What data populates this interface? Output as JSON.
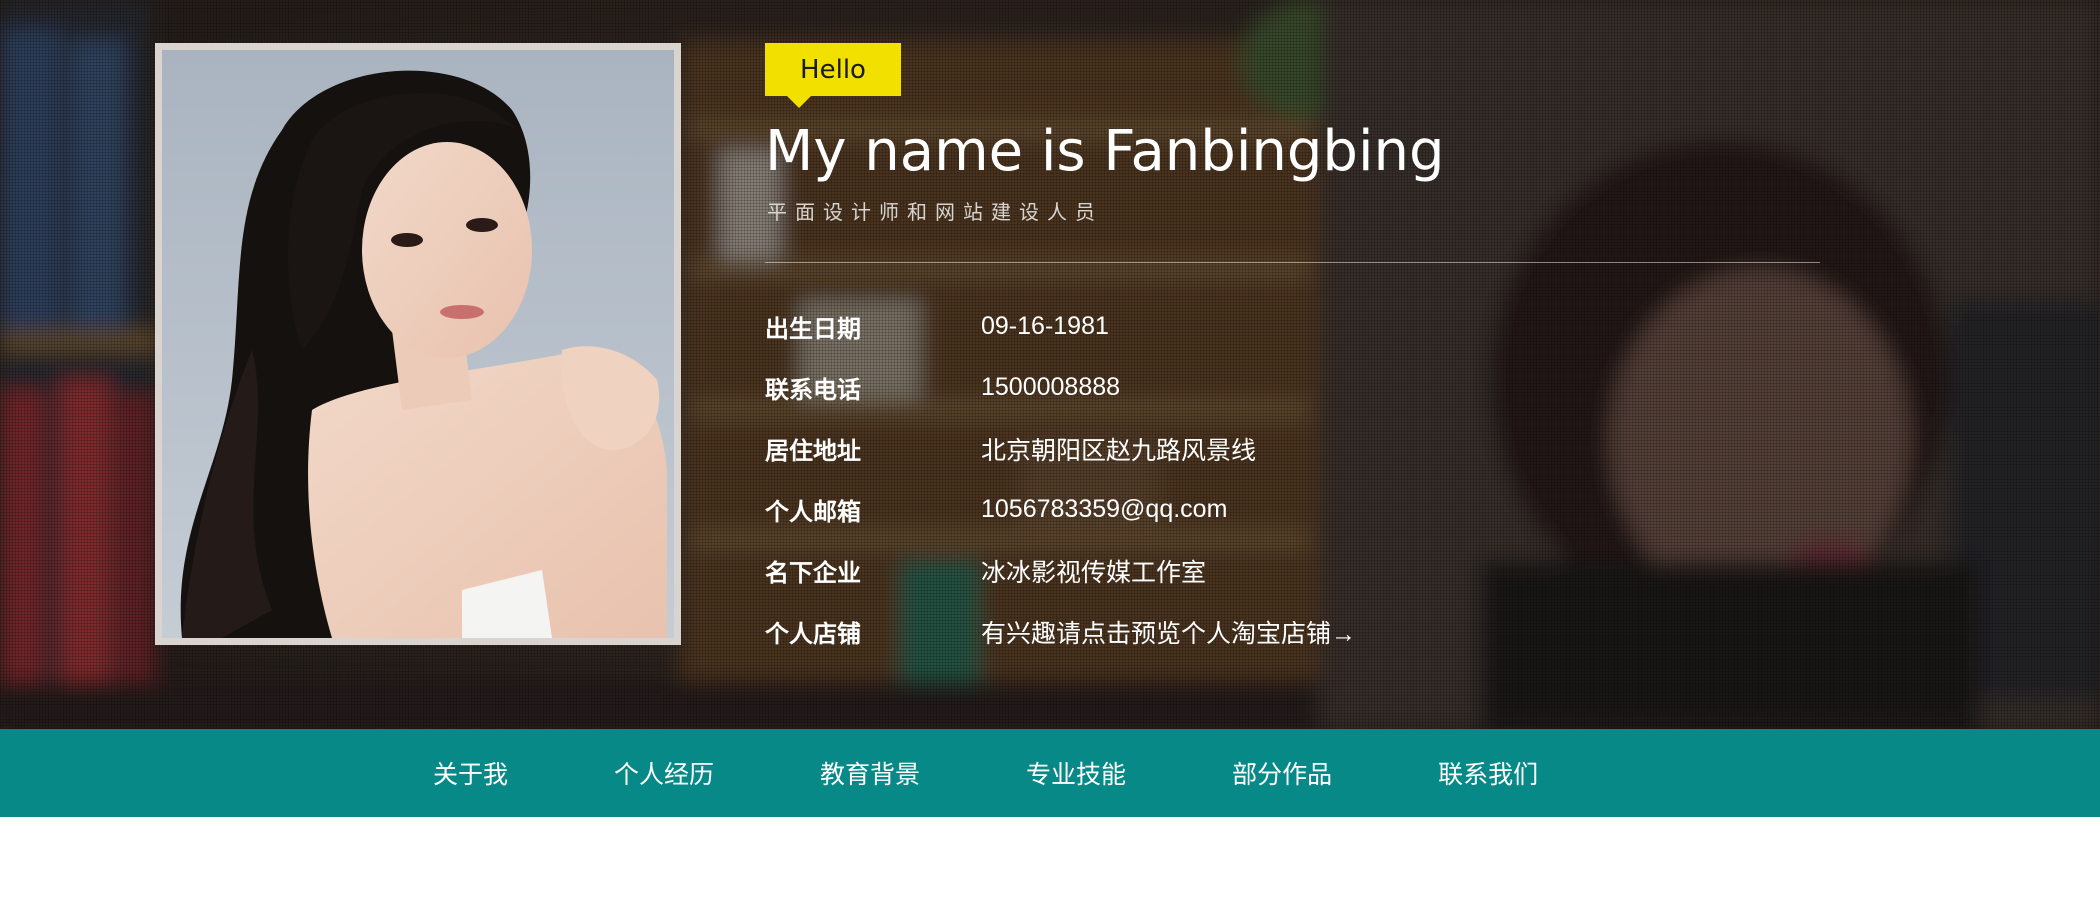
{
  "hero": {
    "hello_badge": "Hello",
    "heading": "My name is Fanbingbing",
    "subtitle": "平面设计师和网站建设人员",
    "info": [
      {
        "label": "出生日期",
        "value": "09-16-1981"
      },
      {
        "label": "联系电话",
        "value": "1500008888"
      },
      {
        "label": "居住地址",
        "value": "北京朝阳区赵九路风景线"
      },
      {
        "label": "个人邮箱",
        "value": "1056783359@qq.com"
      },
      {
        "label": "名下企业",
        "value": "冰冰影视传媒工作室"
      },
      {
        "label": "个人店铺",
        "value": "有兴趣请点击预览个人淘宝店铺→"
      }
    ]
  },
  "nav": {
    "items": [
      "关于我",
      "个人经历",
      "教育背景",
      "专业技能",
      "部分作品",
      "联系我们"
    ]
  },
  "colors": {
    "badge": "#f2e000",
    "nav_background": "#078a87",
    "text_primary": "#ffffff"
  }
}
